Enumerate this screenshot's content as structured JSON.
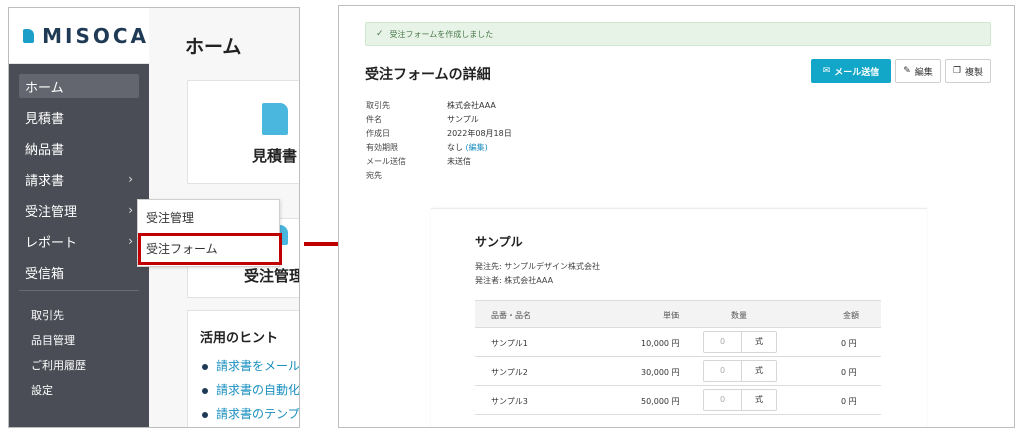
{
  "left_panel": {
    "logo": "MISOCA",
    "nav": {
      "home": "ホーム",
      "quotes": "見積書",
      "delivery": "納品書",
      "invoices": "請求書",
      "orders": "受注管理",
      "reports": "レポート",
      "inbox": "受信箱",
      "clients": "取引先",
      "items": "品目管理",
      "history": "ご利用履歴",
      "settings": "設定"
    },
    "page_title": "ホーム",
    "cards": {
      "quote": "見積書",
      "order": "受注管理"
    },
    "hints": {
      "title": "活用のヒント",
      "links": [
        "請求書をメール",
        "請求書の自動化",
        "請求書のテンプ"
      ]
    },
    "dropdown": {
      "item1": "受注管理",
      "item2": "受注フォーム"
    }
  },
  "right_panel": {
    "alert": "受注フォームを作成しました",
    "title": "受注フォームの詳細",
    "buttons": {
      "mail": "メール送信",
      "edit": "編集",
      "copy": "複製"
    },
    "info": {
      "client_label": "取引先",
      "client_value": "株式会社AAA",
      "subject_label": "件名",
      "subject_value": "サンプル",
      "created_label": "作成日",
      "created_value": "2022年08月18日",
      "expiry_label": "有効期限",
      "expiry_value": "なし",
      "expiry_edit": "(編集)",
      "mail_label": "メール送信",
      "mail_value": "未送信",
      "to_label": "宛先"
    },
    "sheet": {
      "title": "サンプル",
      "orderer_to": "発注先: サンプルデザイン株式会社",
      "orderer": "発注者: 株式会社AAA",
      "headers": {
        "name": "品番・品名",
        "price": "単価",
        "qty": "数量",
        "amount": "金額"
      },
      "rows": [
        {
          "name": "サンプル1",
          "price": "10,000 円",
          "qty": "0",
          "unit": "式",
          "amount": "0 円"
        },
        {
          "name": "サンプル2",
          "price": "30,000 円",
          "qty": "0",
          "unit": "式",
          "amount": "0 円"
        },
        {
          "name": "サンプル3",
          "price": "50,000 円",
          "qty": "0",
          "unit": "式",
          "amount": "0 円"
        }
      ]
    }
  },
  "colors": {
    "sidebar": "#4a4d55",
    "accent": "#12a7c9",
    "highlight": "#c00000",
    "alert_bg": "#e6f3e6"
  }
}
